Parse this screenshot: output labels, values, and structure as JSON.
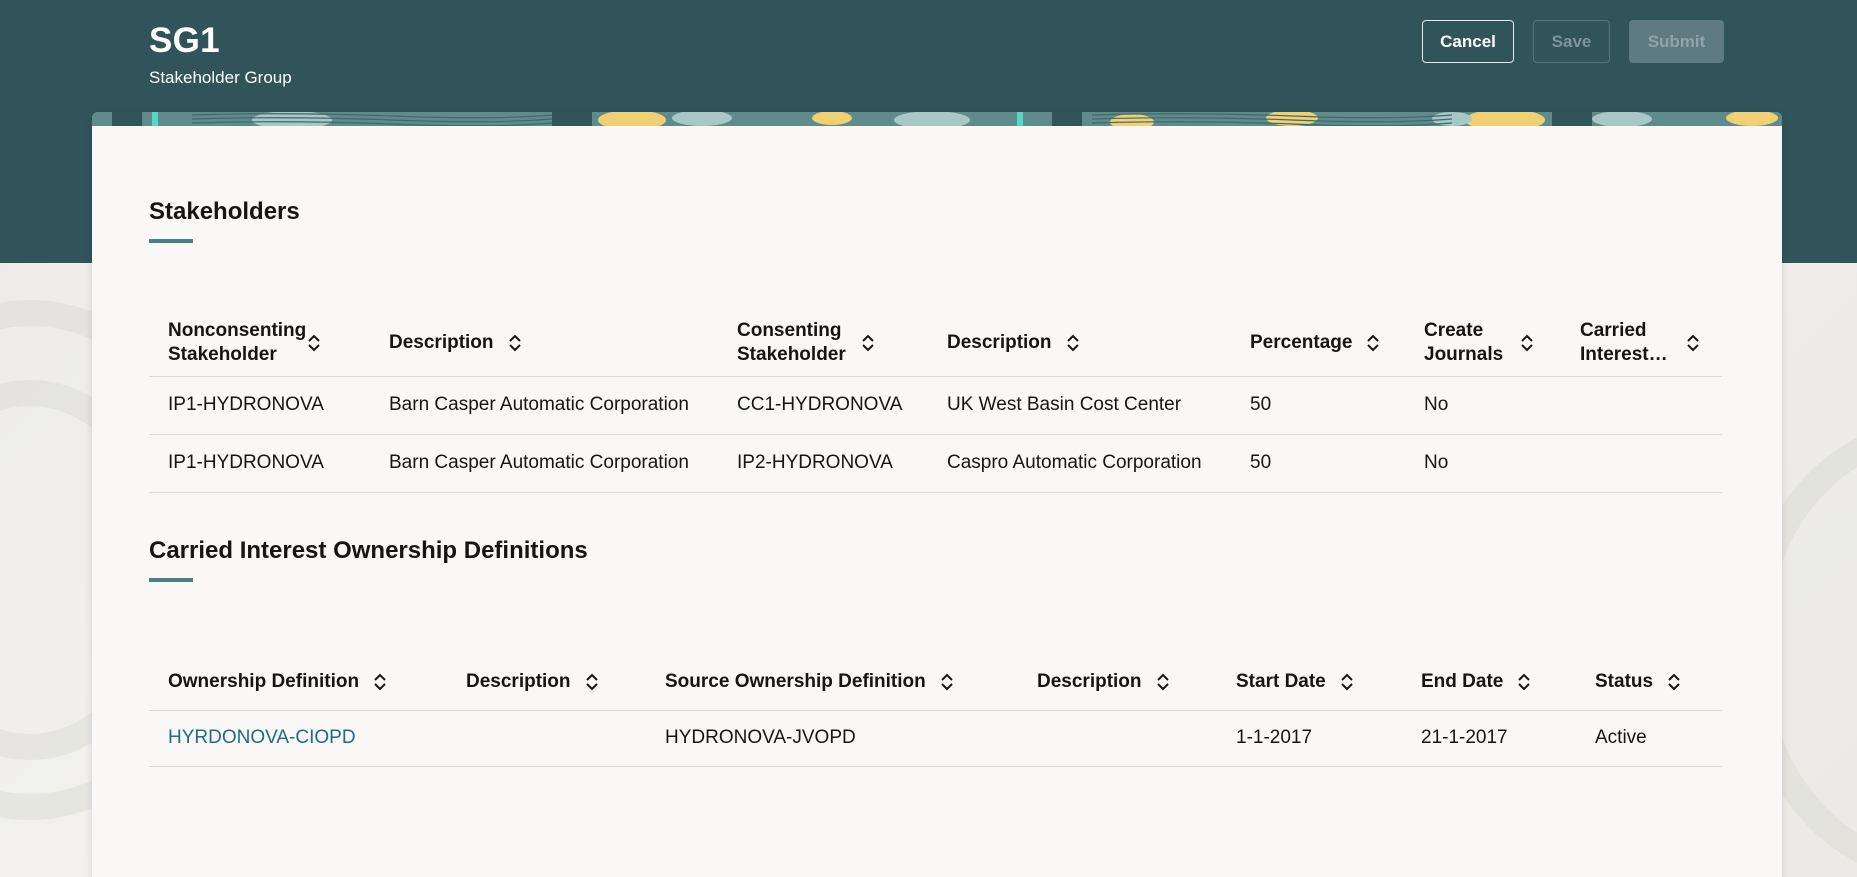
{
  "header": {
    "title": "SG1",
    "subtitle": "Stakeholder Group",
    "buttons": {
      "cancel": "Cancel",
      "save": "Save",
      "submit": "Submit"
    }
  },
  "colors": {
    "header_bg": "#31545a",
    "accent": "#4a7f84",
    "link": "#1f6a87"
  },
  "stakeholders": {
    "title": "Stakeholders",
    "columns": [
      "Nonconsenting Stakeholder",
      "Description",
      "Consenting Stakeholder",
      "Description",
      "Percentage",
      "Create Journals",
      "Carried Interest…"
    ],
    "rows": [
      [
        "IP1-HYDRONOVA",
        "Barn Casper Automatic Corporation",
        "CC1-HYDRONOVA",
        "UK West Basin Cost Center",
        "50",
        "No",
        ""
      ],
      [
        "IP1-HYDRONOVA",
        "Barn Casper Automatic Corporation",
        "IP2-HYDRONOVA",
        "Caspro Automatic Corporation",
        "50",
        "No",
        ""
      ]
    ]
  },
  "ownership": {
    "title": "Carried Interest Ownership Definitions",
    "columns": [
      "Ownership Definition",
      "Description",
      "Source Ownership Definition",
      "Description",
      "Start Date",
      "End Date",
      "Status"
    ],
    "rows": [
      [
        "HYRDONOVA-CIOPD",
        "",
        "HYDRONOVA-JVOPD",
        "",
        "1-1-2017",
        "21-1-2017",
        "Active"
      ]
    ]
  }
}
